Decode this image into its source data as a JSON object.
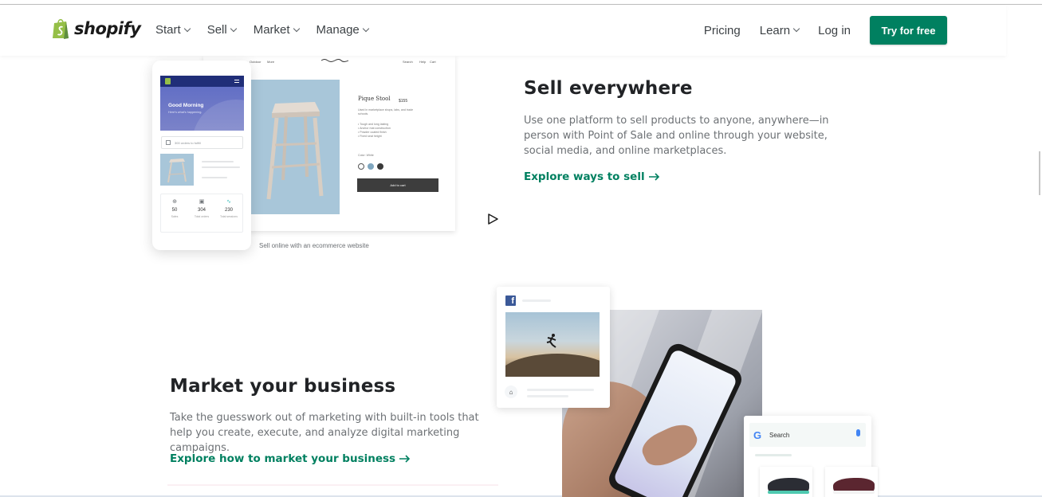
{
  "nav": {
    "logo_text": "shopify",
    "menu": [
      {
        "label": "Start"
      },
      {
        "label": "Sell"
      },
      {
        "label": "Market"
      },
      {
        "label": "Manage"
      }
    ],
    "pricing": "Pricing",
    "learn": "Learn",
    "login": "Log in",
    "cta": "Try for free"
  },
  "sell_section": {
    "title": "Sell everywhere",
    "body": "Use one platform to sell products to anyone, anywhere—in person with Point of Sale and online through your website, social media, and online marketplaces.",
    "link": "Explore ways to sell",
    "caption": "Sell online with an ecommerce website",
    "web_mockup": {
      "nav_left": [
        "Outdoor",
        "More"
      ],
      "nav_right": [
        "Search",
        "Help",
        "Cart"
      ],
      "product_title": "Pique Stool",
      "price": "$155",
      "description": "Used in marketplace shops, labs, and trade schools.",
      "bullets": [
        "Tough and long lasting",
        "Anchor mat construction",
        "Powder coated finish",
        "Fixed seat height"
      ],
      "color_label": "Color: White",
      "add_to_cart": "Add to cart",
      "swatch_colors": [
        "#ffffff",
        "#7fa6bf",
        "#3a3a3a"
      ]
    },
    "phone_mockup": {
      "greeting": "Good Morning",
      "subtext": "Here's what's happening.",
      "search_placeholder": "300 orders to fulfill",
      "stats": [
        {
          "value": "50",
          "label": "Sales"
        },
        {
          "value": "304",
          "label": "Total orders"
        },
        {
          "value": "230",
          "label": "Total sessions"
        }
      ]
    }
  },
  "market_section": {
    "title": "Market your business",
    "body": "Take the guesswork out of marketing with built-in tools that help you create, execute, and analyze digital marketing campaigns.",
    "link": "Explore how to market your business",
    "google_search_text": "Search"
  },
  "colors": {
    "brand_green": "#008060",
    "text": "#212326",
    "muted": "#6d7175",
    "facebook": "#3b5998"
  }
}
